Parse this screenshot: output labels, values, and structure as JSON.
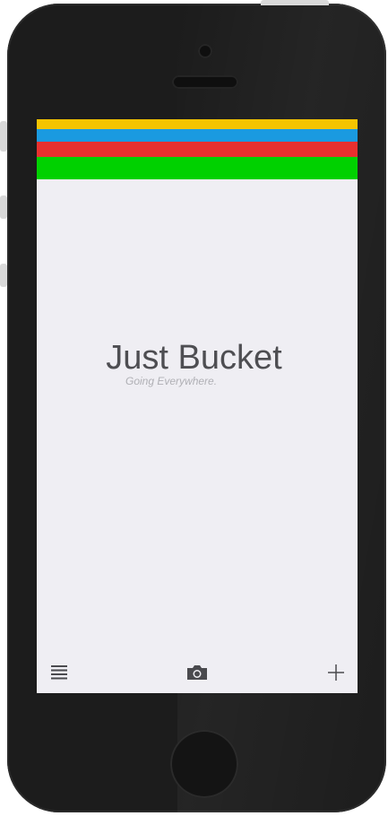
{
  "app": {
    "title": "Just Bucket",
    "tagline": "Going Everywhere."
  },
  "header_stripes": [
    {
      "color": "#f4c400"
    },
    {
      "color": "#1a9ae0"
    },
    {
      "color": "#e8302e"
    },
    {
      "color": "#00d100"
    }
  ],
  "toolbar": {
    "left_icon": "list-icon",
    "center_icon": "camera-icon",
    "right_icon": "plus-icon"
  },
  "colors": {
    "screen_background": "#efeef3",
    "title_text": "#4e4e52",
    "tagline_text": "#b0b0b5",
    "icon": "#4a4a4e",
    "phone_body": "#1c1c1c"
  }
}
